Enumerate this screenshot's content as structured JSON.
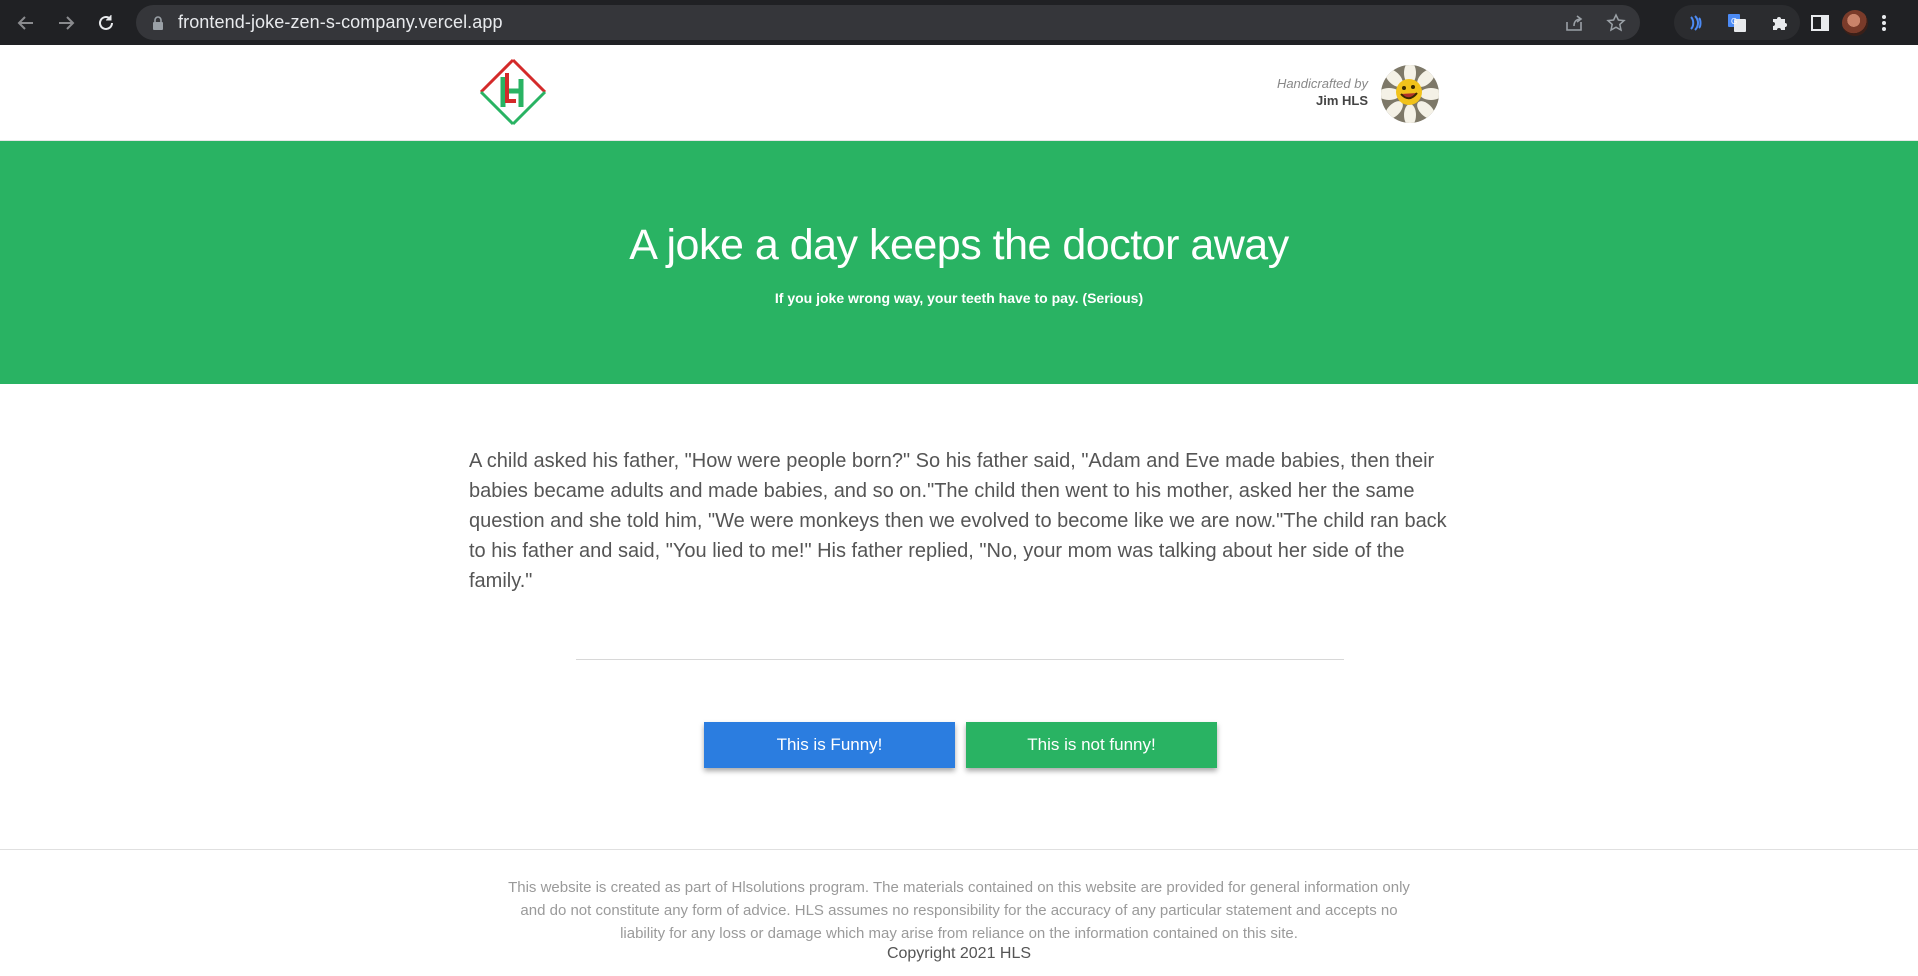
{
  "browser": {
    "url": "frontend-joke-zen-s-company.vercel.app",
    "icons": [
      "back-icon",
      "forward-icon",
      "reload-icon",
      "lock-icon",
      "share-icon",
      "star-icon",
      "extension-icon",
      "translate-icon",
      "puzzle-icon",
      "sidepanel-icon",
      "profile-avatar",
      "menu-icon"
    ]
  },
  "header": {
    "logo_alt": "HLS logo",
    "credit_by": "Handicrafted by",
    "credit_name": "Jim HLS"
  },
  "hero": {
    "title": "A joke a day keeps the doctor away",
    "subtitle": "If you joke wrong way, your teeth have to pay. (Serious)"
  },
  "joke": {
    "text": "A child asked his father, \"How were people born?\" So his father said, \"Adam and Eve made babies, then their babies became adults and made babies, and so on.\"The child then went to his mother, asked her the same question and she told him, \"We were monkeys then we evolved to become like we are now.\"The child ran back to his father and said, \"You lied to me!\" His father replied, \"No, your mom was talking about her side of the family.\""
  },
  "buttons": {
    "funny": "This is Funny!",
    "not_funny": "This is not funny!"
  },
  "footer": {
    "disclaimer": "This website is created as part of Hlsolutions program. The materials contained on this website are provided for general information only and do not constitute any form of advice. HLS assumes no responsibility for the accuracy of any particular statement and accepts no liability for any loss or damage which may arise from reliance on the information contained on this site.",
    "copyright": "Copyright 2021 HLS"
  },
  "colors": {
    "brand_green": "#29b363",
    "funny_blue": "#2b7de0",
    "chrome_dark": "#202124"
  }
}
